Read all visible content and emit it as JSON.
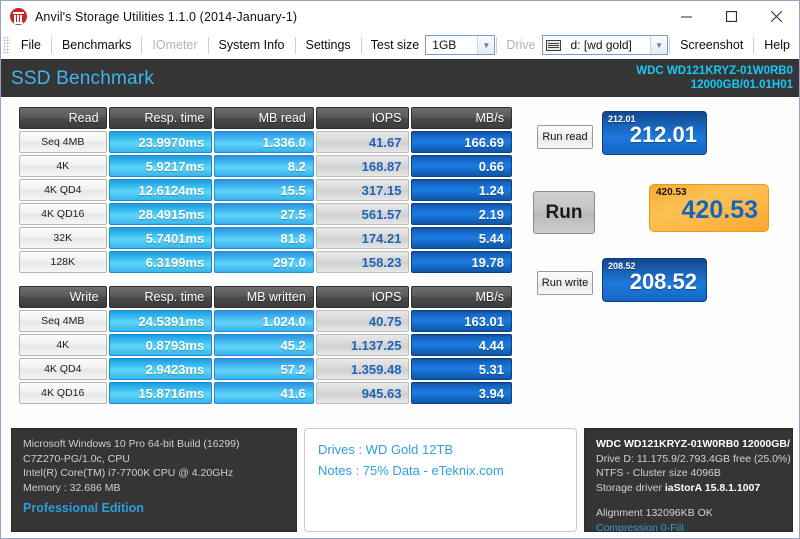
{
  "window": {
    "title": "Anvil's Storage Utilities 1.1.0 (2014-January-1)",
    "minimize": "—",
    "maximize": "□",
    "close": "✕"
  },
  "menubar": {
    "items": [
      {
        "label": "File",
        "disabled": false
      },
      {
        "label": "Benchmarks",
        "disabled": false
      },
      {
        "label": "IOmeter",
        "disabled": true
      },
      {
        "label": "System Info",
        "disabled": false
      },
      {
        "label": "Settings",
        "disabled": false
      }
    ],
    "test_size_label": "Test size",
    "test_size_value": "1GB",
    "drive_label": "Drive",
    "drive_value": "d: [wd gold]",
    "screenshot_label": "Screenshot",
    "help_label": "Help"
  },
  "header": {
    "title": "SSD Benchmark",
    "drive_model": "WDC WD121KRYZ-01W0RB0",
    "drive_capacity": "12000GB/01.01H01",
    "accent_color": "#3fb6f0",
    "cyan_color": "#16c8f5"
  },
  "read_table": {
    "columns": [
      "Read",
      "Resp. time",
      "MB read",
      "IOPS",
      "MB/s"
    ],
    "rows": [
      {
        "label": "Seq 4MB",
        "resp": "23.9970ms",
        "mb": "1.336.0",
        "iops": "41.67",
        "mbs": "166.69"
      },
      {
        "label": "4K",
        "resp": "5.9217ms",
        "mb": "8.2",
        "iops": "168.87",
        "mbs": "0.66"
      },
      {
        "label": "4K QD4",
        "resp": "12.6124ms",
        "mb": "15.5",
        "iops": "317.15",
        "mbs": "1.24"
      },
      {
        "label": "4K QD16",
        "resp": "28.4915ms",
        "mb": "27.5",
        "iops": "561.57",
        "mbs": "2.19"
      },
      {
        "label": "32K",
        "resp": "5.7401ms",
        "mb": "81.8",
        "iops": "174.21",
        "mbs": "5.44"
      },
      {
        "label": "128K",
        "resp": "6.3199ms",
        "mb": "297.0",
        "iops": "158.23",
        "mbs": "19.78"
      }
    ]
  },
  "write_table": {
    "columns": [
      "Write",
      "Resp. time",
      "MB written",
      "IOPS",
      "MB/s"
    ],
    "rows": [
      {
        "label": "Seq 4MB",
        "resp": "24.5391ms",
        "mb": "1.024.0",
        "iops": "40.75",
        "mbs": "163.01"
      },
      {
        "label": "4K",
        "resp": "0.8793ms",
        "mb": "45.2",
        "iops": "1.137.25",
        "mbs": "4.44"
      },
      {
        "label": "4K QD4",
        "resp": "2.9423ms",
        "mb": "57.2",
        "iops": "1.359.48",
        "mbs": "5.31"
      },
      {
        "label": "4K QD16",
        "resp": "15.8716ms",
        "mb": "41.6",
        "iops": "945.63",
        "mbs": "3.94"
      }
    ]
  },
  "controls": {
    "run_read": "Run read",
    "run": "Run",
    "run_write": "Run write",
    "read_score_small": "212.01",
    "read_score": "212.01",
    "total_score_small": "420.53",
    "total_score": "420.53",
    "write_score_small": "208.52",
    "write_score": "208.52"
  },
  "system_info": {
    "os": "Microsoft Windows 10 Pro 64-bit Build (16299)",
    "board": "C7Z270-PG/1.0c, CPU",
    "cpu": "Intel(R) Core(TM) i7-7700K CPU @ 4.20GHz",
    "memory": "Memory : 32.686 MB",
    "edition": "Professional Edition"
  },
  "notes": {
    "drives": "Drives : WD Gold 12TB",
    "notes": "Notes : 75% Data - eTeknix.com"
  },
  "drive_info": {
    "model": "WDC WD121KRYZ-01W0RB0 12000GB/",
    "capacity": "Drive D: 11.175.9/2.793.4GB free (25.0%)",
    "filesystem": "NTFS - Cluster size 4096B",
    "driver_label": "Storage driver",
    "driver_value": "iaStorA 15.8.1.1007",
    "alignment": "Alignment 132096KB OK",
    "compression": "Compression 0-Fill"
  }
}
